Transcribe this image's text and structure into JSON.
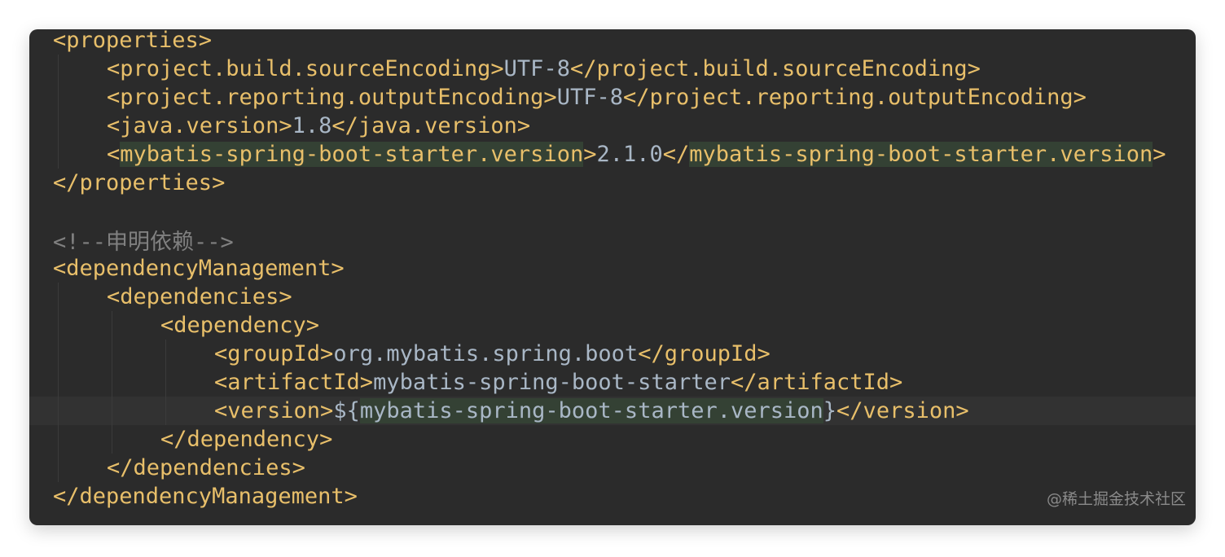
{
  "editor": {
    "lines": [
      {
        "indent": 0,
        "segments": [
          {
            "t": "<properties>",
            "c": "tag"
          }
        ]
      },
      {
        "indent": 1,
        "segments": [
          {
            "t": "<project.build.sourceEncoding>",
            "c": "tag"
          },
          {
            "t": "UTF-8",
            "c": "val"
          },
          {
            "t": "</project.build.sourceEncoding>",
            "c": "tag"
          }
        ]
      },
      {
        "indent": 1,
        "segments": [
          {
            "t": "<project.reporting.outputEncoding>",
            "c": "tag"
          },
          {
            "t": "UTF-8",
            "c": "val"
          },
          {
            "t": "</project.reporting.outputEncoding>",
            "c": "tag"
          }
        ]
      },
      {
        "indent": 1,
        "segments": [
          {
            "t": "<java.version>",
            "c": "tag"
          },
          {
            "t": "1.8",
            "c": "val"
          },
          {
            "t": "</java.version>",
            "c": "tag"
          }
        ]
      },
      {
        "indent": 1,
        "segments": [
          {
            "t": "<",
            "c": "tag"
          },
          {
            "t": "mybatis-spring-boot-starter.version",
            "c": "tag hl"
          },
          {
            "t": ">",
            "c": "tag"
          },
          {
            "t": "2.1.0",
            "c": "val"
          },
          {
            "t": "</",
            "c": "tag"
          },
          {
            "t": "mybatis-spring-boot-starter.version",
            "c": "tag hl"
          },
          {
            "t": ">",
            "c": "tag"
          }
        ]
      },
      {
        "indent": 0,
        "segments": [
          {
            "t": "</properties>",
            "c": "tag"
          }
        ]
      },
      {
        "indent": 0,
        "segments": []
      },
      {
        "indent": 0,
        "segments": [
          {
            "t": "<!--申明依赖-->",
            "c": "cmt"
          }
        ]
      },
      {
        "indent": 0,
        "segments": [
          {
            "t": "<dependencyManagement>",
            "c": "tag"
          }
        ]
      },
      {
        "indent": 1,
        "segments": [
          {
            "t": "<dependencies>",
            "c": "tag"
          }
        ]
      },
      {
        "indent": 2,
        "segments": [
          {
            "t": "<dependency>",
            "c": "tag"
          }
        ]
      },
      {
        "indent": 3,
        "segments": [
          {
            "t": "<groupId>",
            "c": "tag"
          },
          {
            "t": "org.mybatis.spring.boot",
            "c": "val"
          },
          {
            "t": "</groupId>",
            "c": "tag"
          }
        ]
      },
      {
        "indent": 3,
        "segments": [
          {
            "t": "<artifactId>",
            "c": "tag"
          },
          {
            "t": "mybatis-spring-boot-starter",
            "c": "val"
          },
          {
            "t": "</artifactId>",
            "c": "tag"
          }
        ]
      },
      {
        "indent": 3,
        "segments": [
          {
            "t": "<version>",
            "c": "tag"
          },
          {
            "t": "${",
            "c": "val"
          },
          {
            "t": "mybatis-spring-boot-starter.version",
            "c": "val hl"
          },
          {
            "t": "}",
            "c": "val"
          },
          {
            "t": "</version>",
            "c": "tag"
          }
        ]
      },
      {
        "indent": 2,
        "segments": [
          {
            "t": "</dependency>",
            "c": "tag"
          }
        ]
      },
      {
        "indent": 1,
        "segments": [
          {
            "t": "</dependencies>",
            "c": "tag"
          }
        ]
      },
      {
        "indent": 0,
        "segments": [
          {
            "t": "</dependencyManagement>",
            "c": "tag"
          }
        ]
      }
    ],
    "caret_line_index": 13
  },
  "watermark": "@稀土掘金技术社区",
  "colors": {
    "background": "#2b2b2b",
    "tag": "#e8bf6a",
    "text": "#a9b7c6",
    "comment": "#808080",
    "highlight": "#344134"
  }
}
